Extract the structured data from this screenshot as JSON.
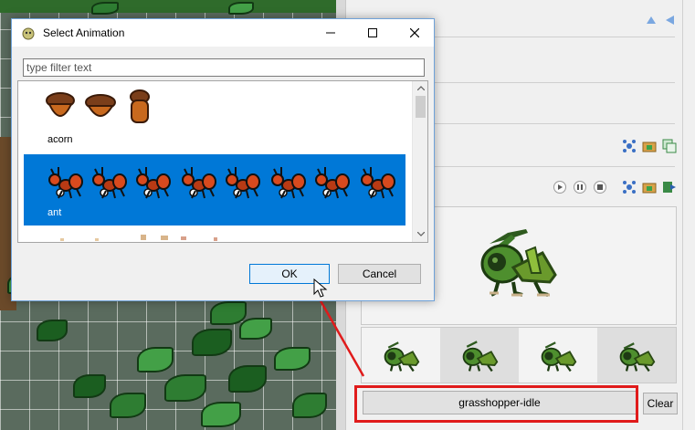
{
  "dialog": {
    "title": "Select Animation",
    "filter_placeholder": "type filter text",
    "filter_value": "",
    "items": [
      {
        "label": "acorn",
        "selected": false
      },
      {
        "label": "ant",
        "selected": true
      }
    ],
    "ok_label": "OK",
    "cancel_label": "Cancel",
    "controls": {
      "minimize": "minimize-icon",
      "maximize": "maximize-icon",
      "close": "close-icon"
    }
  },
  "panel": {
    "animation_button_label": "grasshopper-idle",
    "clear_label": "Clear"
  },
  "colors": {
    "selection": "#0078d7",
    "highlight_box": "#e01b1b",
    "arrow": "#e01b1b"
  }
}
